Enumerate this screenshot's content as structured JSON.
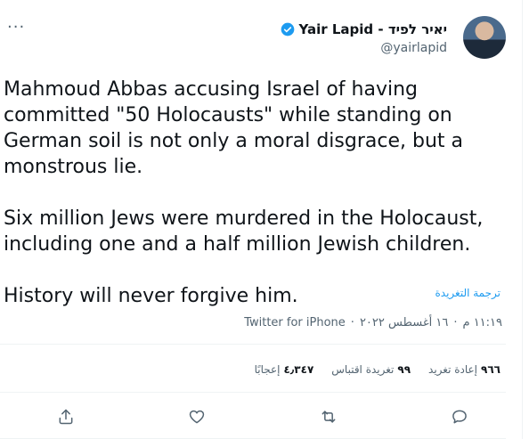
{
  "author": {
    "display_name": "Yair Lapid - יאיר לפיד",
    "handle": "@yairlapid",
    "verified": true
  },
  "tweet": {
    "paragraphs": [
      "Mahmoud Abbas accusing Israel of having committed \"50 Holocausts\" while standing on German soil is not only a moral disgrace, but a monstrous lie.",
      "Six million Jews were murdered in the Holocaust, including one and a half million Jewish children.",
      "History will never forgive him."
    ],
    "translate_label": "ترجمة التغريدة",
    "time": "١١:١٩ م",
    "date": "١٦ أغسطس ٢٠٢٢",
    "source": "Twitter for iPhone",
    "separator": "·"
  },
  "stats": {
    "retweets_count": "٩٦٦",
    "retweets_label": "إعادة تغريد",
    "quotes_count": "٩٩",
    "quotes_label": "تغريدة اقتباس",
    "likes_count": "٤٫٣٤٧",
    "likes_label": "إعجابًا"
  },
  "icons": {
    "more": "more-icon",
    "reply": "reply-icon",
    "retweet": "retweet-icon",
    "like": "heart-icon",
    "share": "share-icon",
    "verified": "verified-badge-icon"
  },
  "colors": {
    "accent": "#1d9bf0",
    "text": "#0f1419",
    "muted": "#536471"
  }
}
